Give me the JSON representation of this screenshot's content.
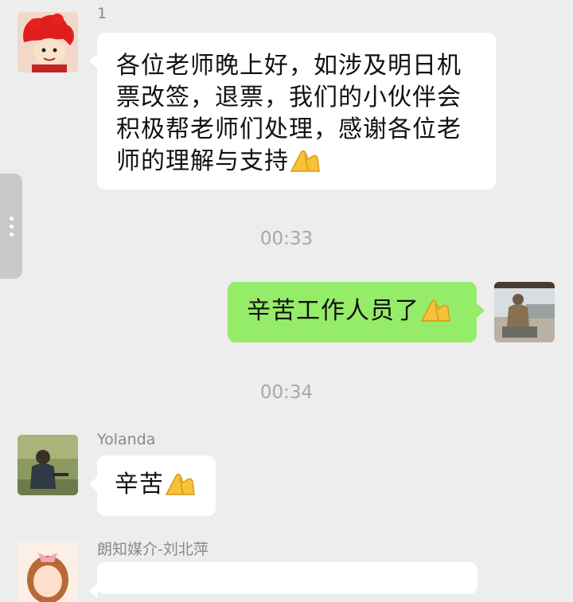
{
  "messages": [
    {
      "sender": "1",
      "text": "各位老师晚上好，如涉及明日机票改签，退票，我们的小伙伴会积极帮老师们处理，感谢各位老师的理解与支持",
      "emoji": "folded-hands"
    },
    {
      "time": "00:33"
    },
    {
      "text": "辛苦工作人员了",
      "emoji": "folded-hands"
    },
    {
      "time": "00:34"
    },
    {
      "sender": "Yolanda",
      "text": "辛苦",
      "emoji": "folded-hands"
    },
    {
      "sender": "朗知媒介-刘北萍",
      "text": ""
    }
  ],
  "colors": {
    "background": "#ededed",
    "incoming_bubble": "#ffffff",
    "outgoing_bubble": "#95ec69",
    "timestamp": "#a8a8a8",
    "sender_name": "#8a8a8a"
  }
}
